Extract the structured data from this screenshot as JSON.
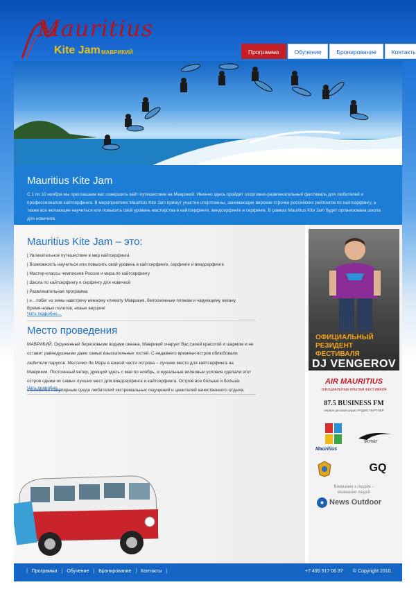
{
  "logo": {
    "script": "Mauritius",
    "title": "Kite Jam",
    "subtitle": "МАВРИКИЙ"
  },
  "nav": {
    "items": [
      {
        "label": "Программа",
        "active": true
      },
      {
        "label": "Обучение",
        "active": false
      },
      {
        "label": "Бронирование",
        "active": false
      },
      {
        "label": "Контакты",
        "active": false
      }
    ]
  },
  "intro": {
    "title": "Mauritius Kite Jam",
    "text": "С 1 по 10 ноября мы приглашаем вас совершить кайт-путешествие на Маврикий. Именно здесь пройдет спортивно-развлекательный фестиваль для любителей и профессионалов кайтсерфинга. В мероприятиях Mauritius Kite Jam примут участие спортсмены, занимающие верхние строчки российских рейтингов по кайтсерфингу, а также все желающие научиться или повысить свой уровень мастерства в кайтсерфинге, виндсерфинге и серфинге. В рамках Mauritius Kite Jam будет организована школа для новичков."
  },
  "about": {
    "title": "Mauritius Kite Jam – это:",
    "items": [
      "| Увлекательное путешествие в мир кайтсерфинга",
      "| Возможность научиться или повысить свой уровень в кайтсерфинге, серфинге и виндсерфинге",
      "|  Мастер-классы чемпионов России и мира по кайтсерфингу",
      "|  Школа по кайтсерфингу и серфингу для новичкой",
      "| Развлекательная программа",
      "|  и…побег из зимы навстречу  нежному климату Маврикия, белоснежным пляжам  и чарующему океану."
    ],
    "tagline": "Время  новых полетов, новых вершин!",
    "more": "Чать подробно…"
  },
  "venue": {
    "title": "Место проведения",
    "text": "МАВРИКИЙ. Окруженный бирюзовыми водами океана, Маврикий очарует Вас своей красотой и шармом и не оставит равнодушными даже самых взыскательных гостей. С недавнего времени остров облюбовали любители парусов. Местечко Ле Морн в южной части острова – лучшее место для кайтсерфинга на Маврикии. Постоянный ветер, дующий здесь с мая по ноябрь, и идеальные волновые условия сделали этот остров одним их самых лучших мест для виндсерфинга и кайтсерфинга. Остров все больше и больше становится популярным среди любителей экстремальных ощущений и ценителей качественного отдыха.",
    "more": "Чать подробно…"
  },
  "poster": {
    "line1": "ОФИЦИАЛЬНЫЙ",
    "line2": "РЕЗИДЕНТ",
    "line3": "ФЕСТИВАЛЯ",
    "name": "DJ VENGEROV"
  },
  "sponsors": {
    "air": "AIR MAURITIUS",
    "air_sub": "ОФИЦИАЛЬНЫЕ КРЫЛЬЯ ФЕСТИВАЛЯ",
    "bfm": "87.5 BUSINESS FM",
    "bfm_sub": "первое деловое радио   РАДИО ПАРТНЕР",
    "mauritius": "Mauritius",
    "gq": "GQ",
    "extreme": "Внимание к людям –\nвнимание людей",
    "news": "News Outdoor"
  },
  "footer": {
    "nav": [
      "Программа",
      "Обучение",
      "Бронирование",
      "Контакты"
    ],
    "phone": "+7 495 517 06 37",
    "copyright": "© Copyright 2010."
  },
  "colors": {
    "brand_blue": "#1c7dd6",
    "accent_red": "#c51d24",
    "link_blue": "#1d6fc9"
  }
}
